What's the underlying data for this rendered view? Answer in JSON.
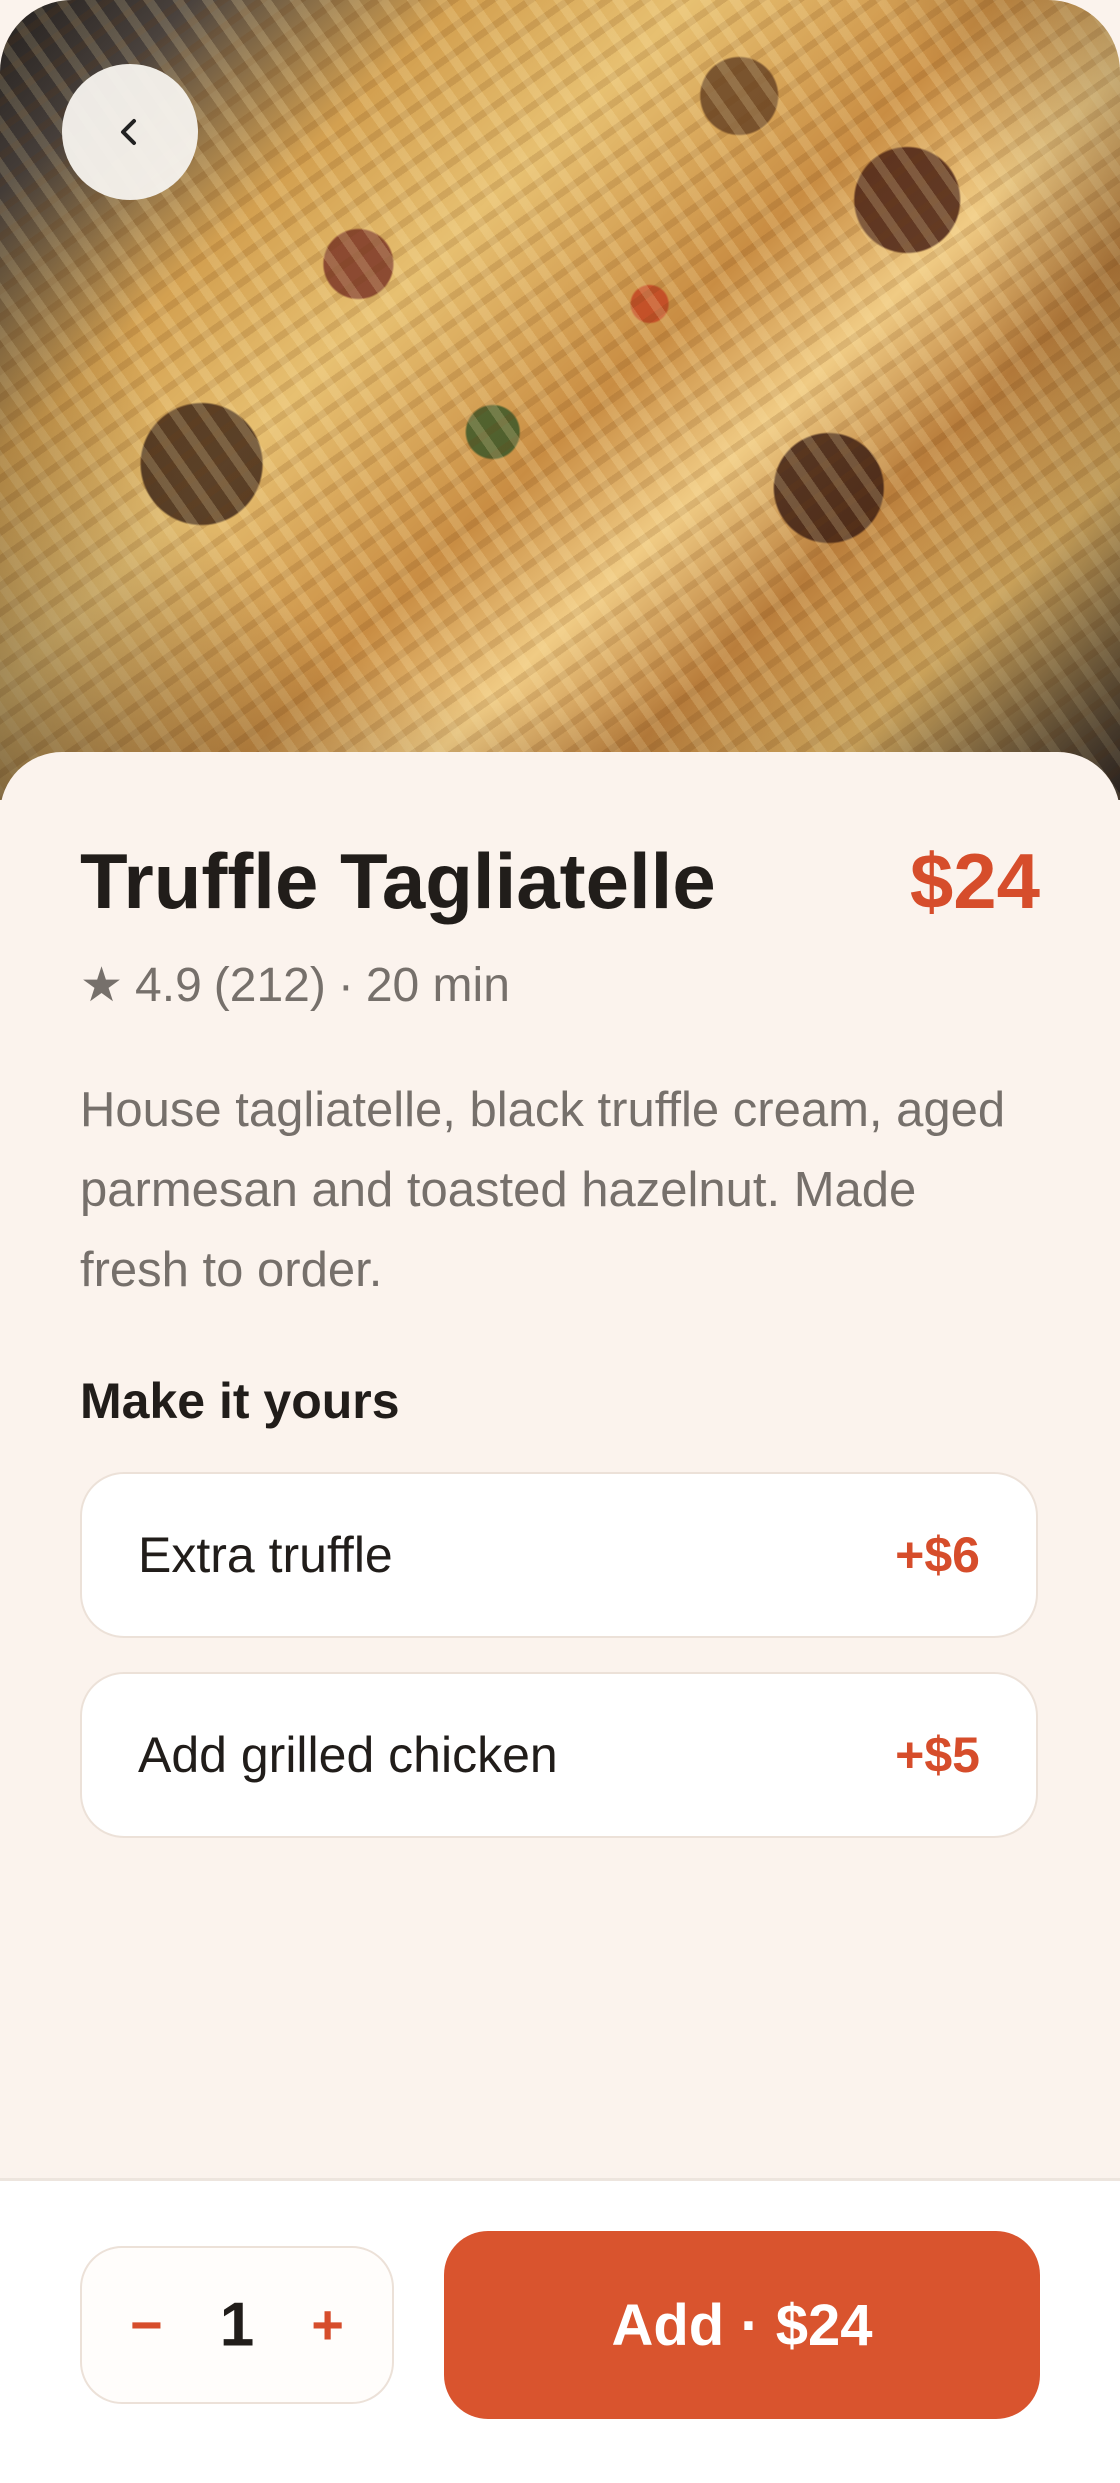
{
  "screen": {
    "title": "Truffle Tagliatelle",
    "price": "$24",
    "rating": "4.9",
    "review_count": "(212)",
    "meta_separator": "·",
    "time": "20 min",
    "description": "House tagliatelle, black truffle cream, aged parmesan and toasted hazelnut. Made fresh to order."
  },
  "customizations": {
    "section_title": "Make it yours",
    "options": [
      {
        "label": "Extra truffle",
        "price": "+$6"
      },
      {
        "label": "Add grilled chicken",
        "price": "+$5"
      }
    ]
  },
  "footer": {
    "quantity": "1",
    "decrement_symbol": "−",
    "increment_symbol": "+",
    "add_label": "Add · $24"
  },
  "icons": {
    "back": "chevron-left-icon",
    "rating": "star-icon",
    "hero": "food-image"
  },
  "colors": {
    "accent": "#d9542e",
    "price": "#d64d2b",
    "background": "#fbf3ed",
    "text": "#211d1a",
    "muted_text": "#76706b"
  }
}
